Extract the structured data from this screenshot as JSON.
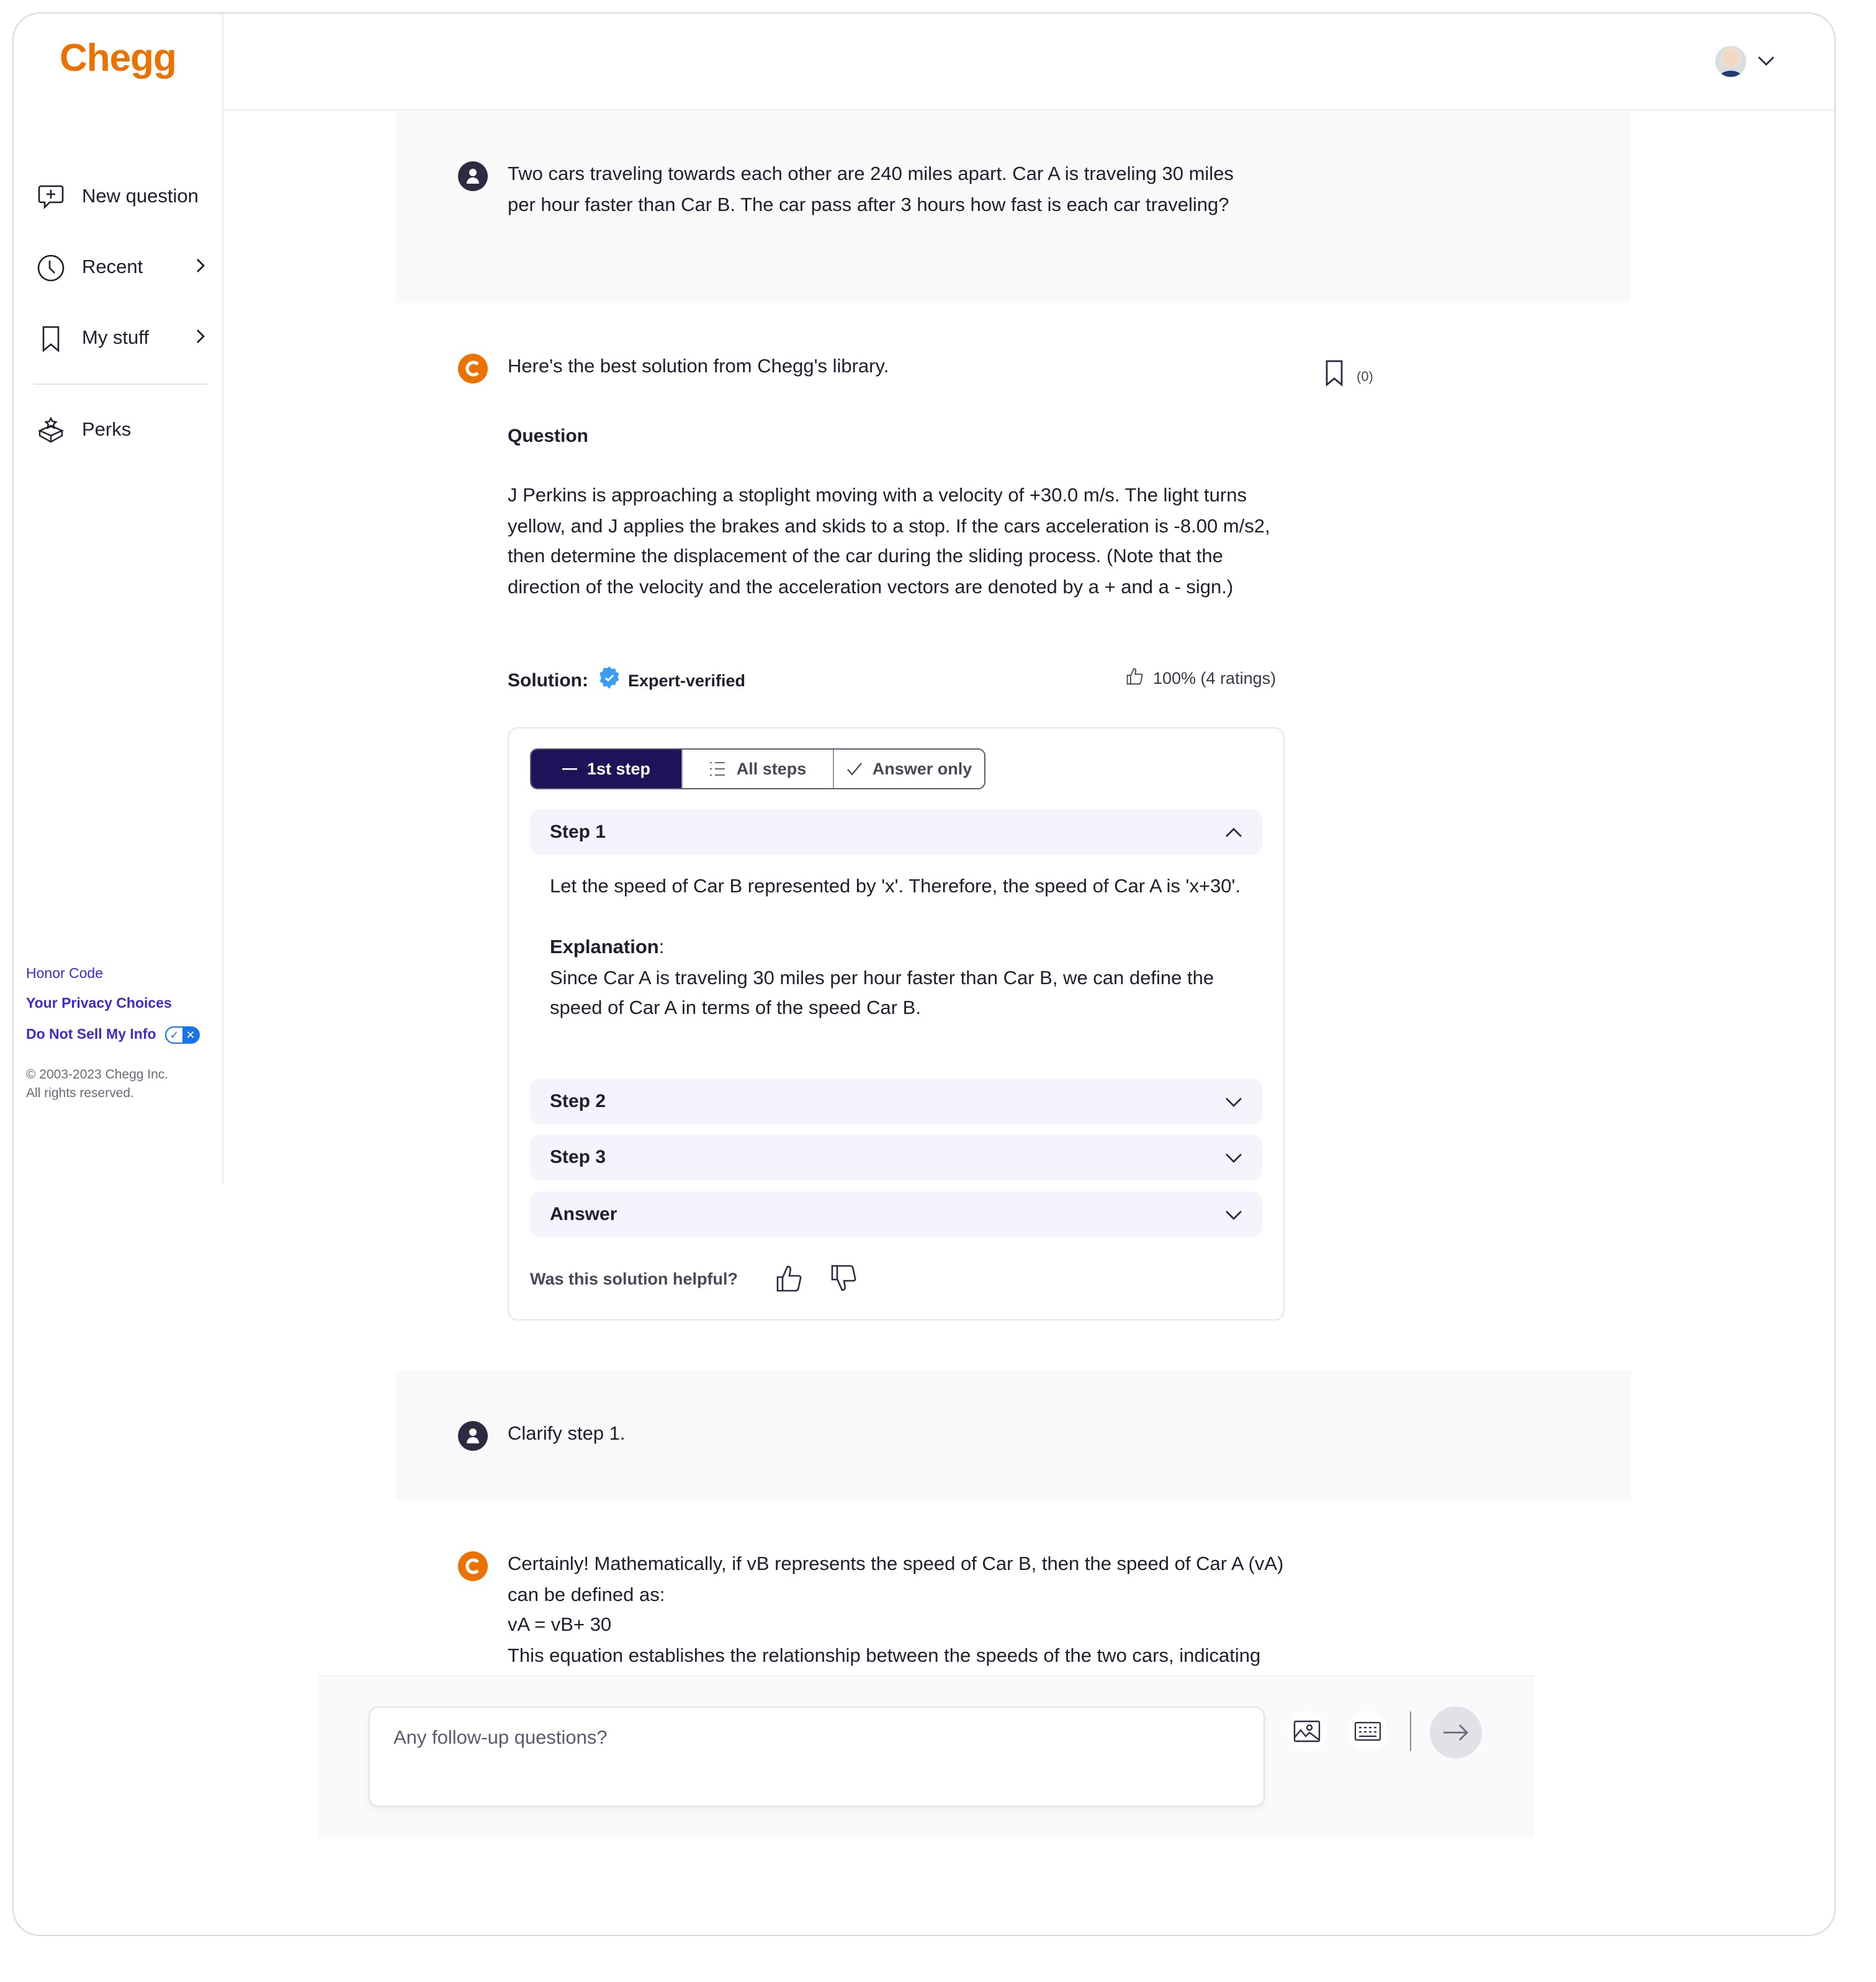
{
  "app": {
    "brand": "Chegg",
    "brand_color": "#eb7100",
    "accent_color": "#1f1258",
    "link_color": "#3d2ac9"
  },
  "sidebar": {
    "items": [
      {
        "label": "New question",
        "icon": "chat-plus-icon",
        "has_chevron": false
      },
      {
        "label": "Recent",
        "icon": "clock-icon",
        "has_chevron": true
      },
      {
        "label": "My stuff",
        "icon": "bookmark-icon",
        "has_chevron": true
      },
      {
        "label": "Perks",
        "icon": "gift-box-icon",
        "has_chevron": false
      }
    ],
    "chevron": "›",
    "footer": {
      "honor_code": "Honor Code",
      "privacy_choices": "Your Privacy Choices",
      "do_not_sell": "Do Not Sell My Info",
      "toggle_on": "✓",
      "toggle_off": "✕",
      "copyright_line1": "© 2003-2023 Chegg Inc.",
      "copyright_line2": "All rights reserved."
    }
  },
  "header": {
    "avatar_alt": "User profile",
    "menu_chevron": "chevron-down"
  },
  "conversation": {
    "user_question": "Two cars traveling towards each other are 240 miles apart. Car A is traveling 30 miles per hour faster than Car B. The car pass after 3 hours how fast is each car traveling?",
    "solution_intro": "Here's the best solution from Chegg's library.",
    "bookmark_count": "(0)",
    "question_heading": "Question",
    "library_question": "J Perkins is approaching a stoplight moving with a velocity of +30.0 m/s. The light turns yellow, and J applies the brakes and skids to a stop. If the cars acceleration is -8.00 m/s2, then determine the displacement of the car during the sliding process. (Note that the direction of the velocity and the acceleration vectors are denoted by a + and a - sign.)",
    "solution_label": "Solution:",
    "verified_label": "Expert-verified",
    "rating": "100% (4 ratings)",
    "view_tabs": [
      {
        "label": "1st step",
        "icon": "dash-icon",
        "active": true
      },
      {
        "label": "All steps",
        "icon": "list-icon",
        "active": false
      },
      {
        "label": "Answer only",
        "icon": "check-icon",
        "active": false
      }
    ],
    "steps": [
      {
        "title": "Step 1",
        "expanded": true
      },
      {
        "title": "Step 2",
        "expanded": false
      },
      {
        "title": "Step 3",
        "expanded": false
      },
      {
        "title": "Answer",
        "expanded": false
      }
    ],
    "step1_text": "Let the speed of Car B represented by 'x'. Therefore, the speed of Car A is 'x+30'.",
    "explanation_label": "Explanation",
    "explanation_colon": ":",
    "explanation_text": "Since Car A is traveling 30 miles per hour faster than Car B, we can define the speed of Car A in terms of the speed Car B.",
    "helpful_prompt": "Was this solution helpful?",
    "followup_user": "Clarify step 1.",
    "followup_answer_lines": [
      "Certainly! Mathematically, if vB represents the speed of Car B, then the speed of Car A (vA) can be defined as:",
      "vA = vB+ 30",
      "This equation establishes the relationship between the speeds of the two cars, indicating that Car A is faster by a constant amount (30 miles per hour) compared to Car B."
    ]
  },
  "composer": {
    "placeholder": "Any follow-up questions?",
    "value": ""
  }
}
